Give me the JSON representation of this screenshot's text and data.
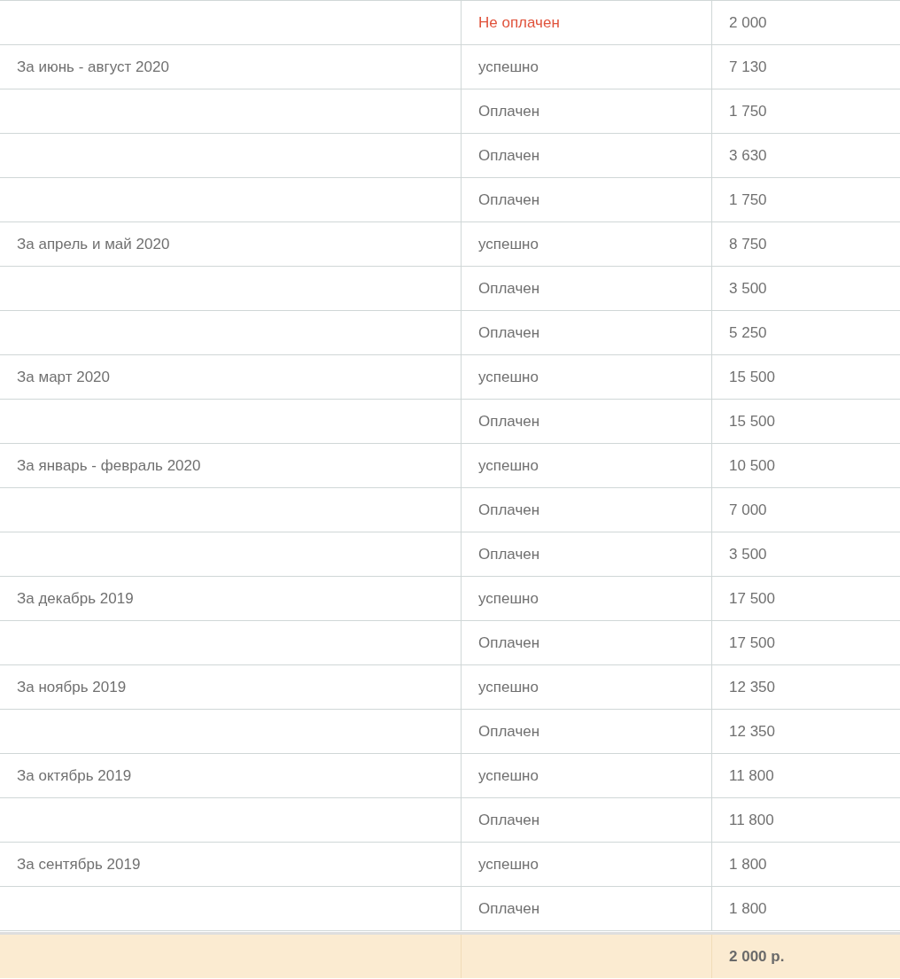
{
  "rows": [
    {
      "description": null,
      "status": "Не оплачен",
      "kind": "unpaid",
      "amount": "2 000"
    },
    {
      "description": "За июнь - август 2020",
      "status": "успешно",
      "kind": "success",
      "amount": "7 130"
    },
    {
      "description": null,
      "status": "Оплачен",
      "kind": "paid",
      "amount": "1 750"
    },
    {
      "description": null,
      "status": "Оплачен",
      "kind": "paid",
      "amount": "3 630"
    },
    {
      "description": null,
      "status": "Оплачен",
      "kind": "paid",
      "amount": "1 750"
    },
    {
      "description": "За апрель и май 2020",
      "status": "успешно",
      "kind": "success",
      "amount": "8 750"
    },
    {
      "description": null,
      "status": "Оплачен",
      "kind": "paid",
      "amount": "3 500"
    },
    {
      "description": null,
      "status": "Оплачен",
      "kind": "paid",
      "amount": "5 250"
    },
    {
      "description": "За март 2020",
      "status": "успешно",
      "kind": "success",
      "amount": "15 500"
    },
    {
      "description": null,
      "status": "Оплачен",
      "kind": "paid",
      "amount": "15 500"
    },
    {
      "description": "За январь - февраль 2020",
      "status": "успешно",
      "kind": "success",
      "amount": "10 500"
    },
    {
      "description": null,
      "status": "Оплачен",
      "kind": "paid",
      "amount": "7 000"
    },
    {
      "description": null,
      "status": "Оплачен",
      "kind": "paid",
      "amount": "3 500"
    },
    {
      "description": "За декабрь 2019",
      "status": "успешно",
      "kind": "success",
      "amount": "17 500"
    },
    {
      "description": null,
      "status": "Оплачен",
      "kind": "paid",
      "amount": "17 500"
    },
    {
      "description": "За ноябрь 2019",
      "status": "успешно",
      "kind": "success",
      "amount": "12 350"
    },
    {
      "description": null,
      "status": "Оплачен",
      "kind": "paid",
      "amount": "12 350"
    },
    {
      "description": "За октябрь 2019",
      "status": "успешно",
      "kind": "success",
      "amount": "11 800"
    },
    {
      "description": null,
      "status": "Оплачен",
      "kind": "paid",
      "amount": "11 800"
    },
    {
      "description": "За сентябрь 2019",
      "status": "успешно",
      "kind": "success",
      "amount": "1 800"
    },
    {
      "description": null,
      "status": "Оплачен",
      "kind": "paid",
      "amount": "1 800"
    }
  ],
  "total": "2 000 р."
}
